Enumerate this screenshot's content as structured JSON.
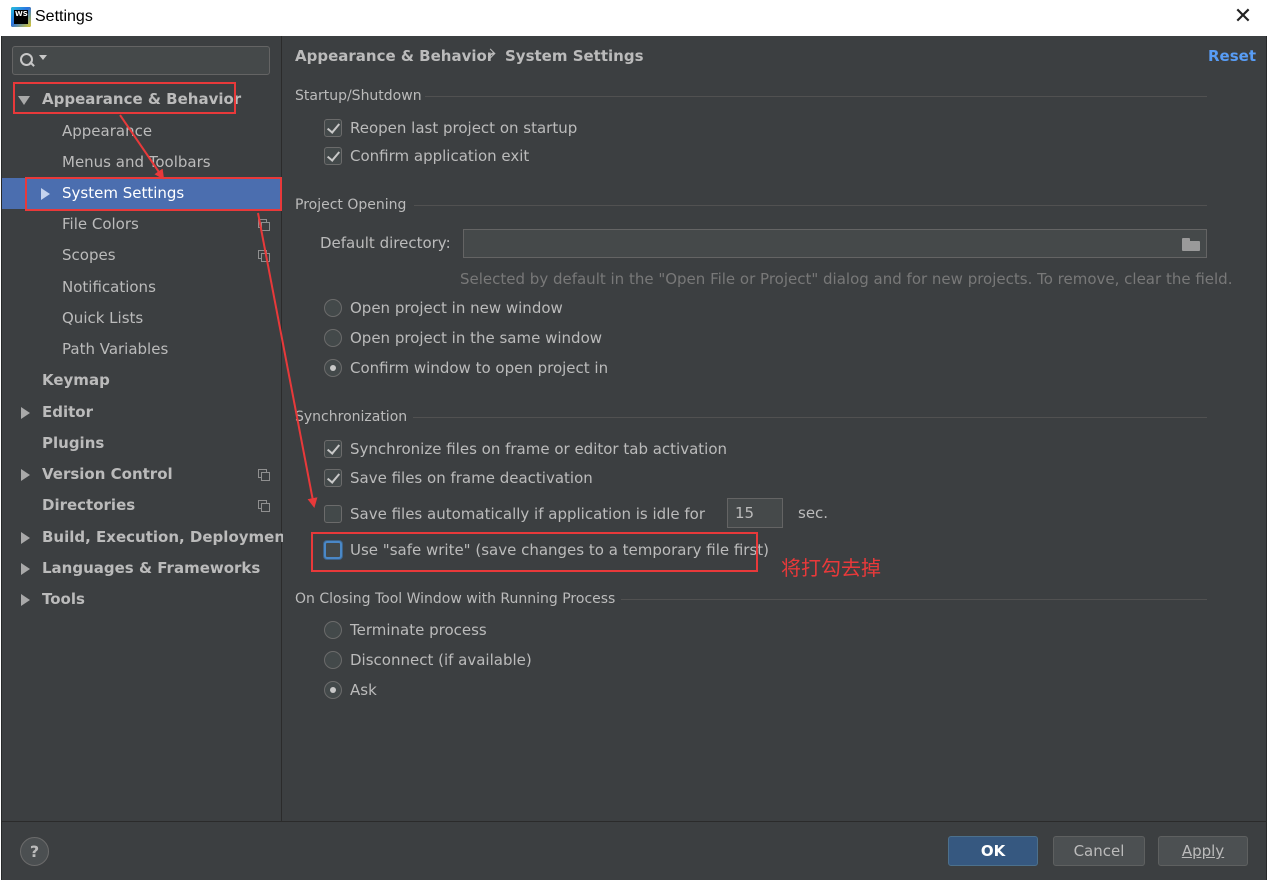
{
  "window": {
    "title": "Settings",
    "app_icon_text": "WS"
  },
  "sidebar": {
    "search_placeholder": "",
    "items": [
      {
        "label": "Appearance & Behavior",
        "bold": true,
        "expand": "down"
      },
      {
        "label": "Appearance"
      },
      {
        "label": "Menus and Toolbars"
      },
      {
        "label": "System Settings",
        "selected": true,
        "expand": "right"
      },
      {
        "label": "File Colors",
        "icon": "copy-icon"
      },
      {
        "label": "Scopes",
        "icon": "copy-icon"
      },
      {
        "label": "Notifications"
      },
      {
        "label": "Quick Lists"
      },
      {
        "label": "Path Variables"
      },
      {
        "label": "Keymap",
        "bold": true
      },
      {
        "label": "Editor",
        "bold": true,
        "expand": "right"
      },
      {
        "label": "Plugins",
        "bold": true
      },
      {
        "label": "Version Control",
        "bold": true,
        "expand": "right",
        "icon": "copy-icon"
      },
      {
        "label": "Directories",
        "bold": true,
        "icon": "copy-icon"
      },
      {
        "label": "Build, Execution, Deployment",
        "bold": true,
        "expand": "right"
      },
      {
        "label": "Languages & Frameworks",
        "bold": true,
        "expand": "right"
      },
      {
        "label": "Tools",
        "bold": true,
        "expand": "right"
      }
    ]
  },
  "header": {
    "breadcrumb_parent": "Appearance & Behavior",
    "breadcrumb_current": "System Settings",
    "reset_label": "Reset"
  },
  "startup": {
    "title": "Startup/Shutdown",
    "reopen_label": "Reopen last project on startup",
    "reopen_checked": true,
    "confirm_exit_label": "Confirm application exit",
    "confirm_exit_checked": true
  },
  "project_opening": {
    "title": "Project Opening",
    "default_dir_label": "Default directory:",
    "default_dir_value": "",
    "hint": "Selected by default in the \"Open File or Project\" dialog and for new projects. To remove, clear the field.",
    "options": [
      "Open project in new window",
      "Open project in the same window",
      "Confirm window to open project in"
    ],
    "selected_option": 2
  },
  "sync": {
    "title": "Synchronization",
    "sync_files_label": "Synchronize files on frame or editor tab activation",
    "sync_files_checked": true,
    "save_deactivation_label": "Save files on frame deactivation",
    "save_deactivation_checked": true,
    "save_auto_label": "Save files automatically if application is idle for",
    "save_auto_checked": false,
    "idle_seconds": "15",
    "sec_label": "sec.",
    "safe_write_label": "Use \"safe write\" (save changes to a temporary file first)",
    "safe_write_checked": false
  },
  "closing": {
    "title": "On Closing Tool Window with Running Process",
    "options": [
      "Terminate process",
      "Disconnect (if available)",
      "Ask"
    ],
    "selected_option": 2
  },
  "annotation": {
    "note": "将打勾去掉",
    "color": "#e8393a"
  },
  "footer": {
    "help_label": "?",
    "ok_label": "OK",
    "cancel_label": "Cancel",
    "apply_label": "Apply"
  },
  "colors": {
    "background": "#3c3f41",
    "selection": "#4b6eaf",
    "link": "#589df6",
    "text": "#bbbbbb",
    "primary_button": "#365880"
  }
}
